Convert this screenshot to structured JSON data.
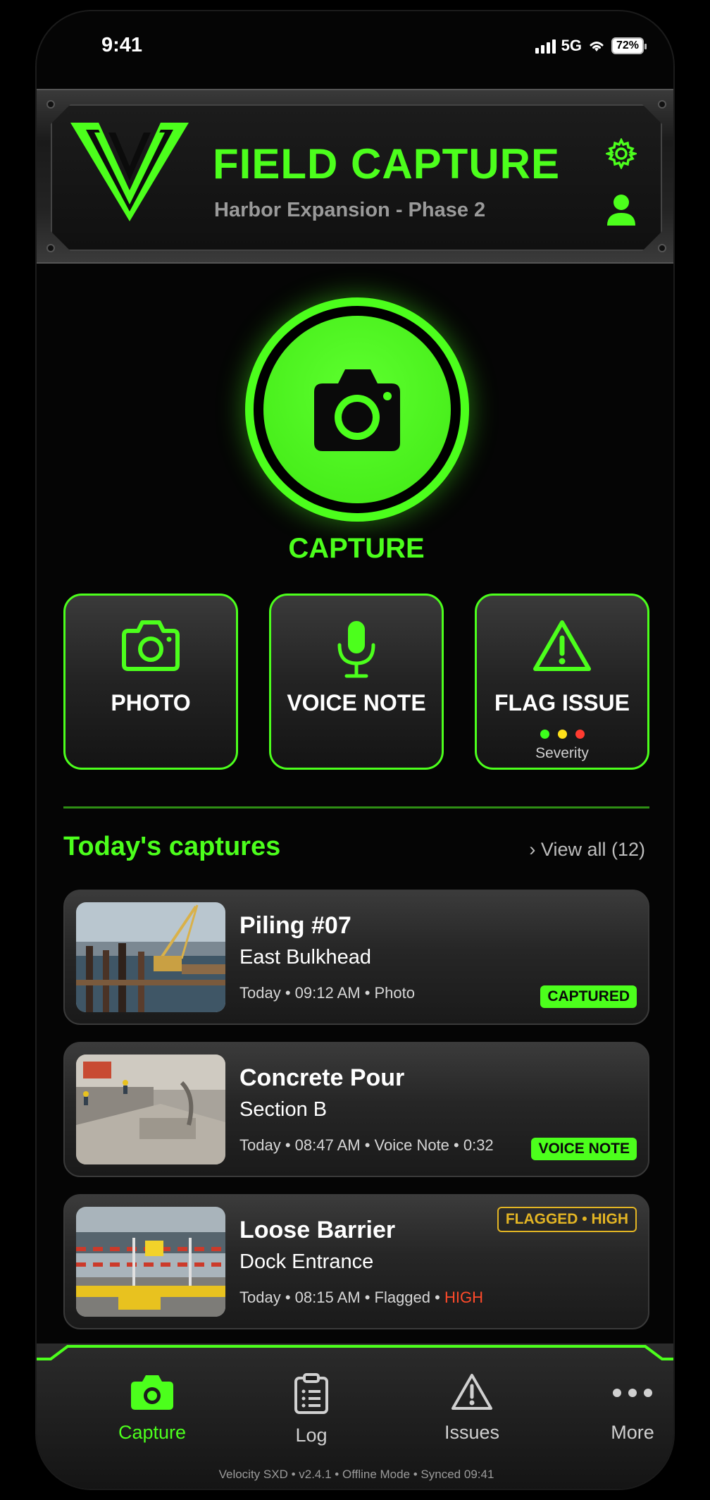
{
  "status_bar": {
    "time": "9:41",
    "network": "5G",
    "battery": "72%"
  },
  "header": {
    "title": "FIELD CAPTURE",
    "subtitle": "Harbor Expansion - Phase 2"
  },
  "capture": {
    "label": "CAPTURE"
  },
  "actions": [
    {
      "label": "PHOTO",
      "icon": "camera-icon"
    },
    {
      "label": "VOICE NOTE",
      "icon": "microphone-icon"
    },
    {
      "label": "FLAG ISSUE",
      "icon": "warning-icon",
      "severity_label": "Severity",
      "severity_colors": [
        "#3cff1c",
        "#ffe01a",
        "#ff3b30"
      ]
    }
  ],
  "section": {
    "title": "Today's captures",
    "view_all": "View all (12)"
  },
  "captures": [
    {
      "title": "Piling #07",
      "subtitle": "East Bulkhead",
      "meta": "Today • 09:12 AM • Photo",
      "badge": "CAPTURED"
    },
    {
      "title": "Concrete Pour",
      "subtitle": "Section B",
      "meta": "Today • 08:47 AM • Voice Note • 0:32",
      "badge": "VOICE NOTE"
    },
    {
      "title": "Loose Barrier",
      "subtitle": "Dock Entrance",
      "meta_prefix": "Today • 08:15 AM • Flagged • ",
      "meta_high": "HIGH",
      "badge": "FLAGGED • HIGH"
    }
  ],
  "tabs": [
    {
      "label": "Capture",
      "icon": "camera-icon",
      "active": true
    },
    {
      "label": "Log",
      "icon": "clipboard-icon"
    },
    {
      "label": "Issues",
      "icon": "warning-icon"
    },
    {
      "label": "More",
      "icon": "more-icon"
    }
  ],
  "footer": "Velocity SXD • v2.4.1 • Offline Mode • Synced 09:41",
  "colors": {
    "accent": "#4cff1c",
    "warning": "#e3b524",
    "danger": "#ff4a2a"
  }
}
